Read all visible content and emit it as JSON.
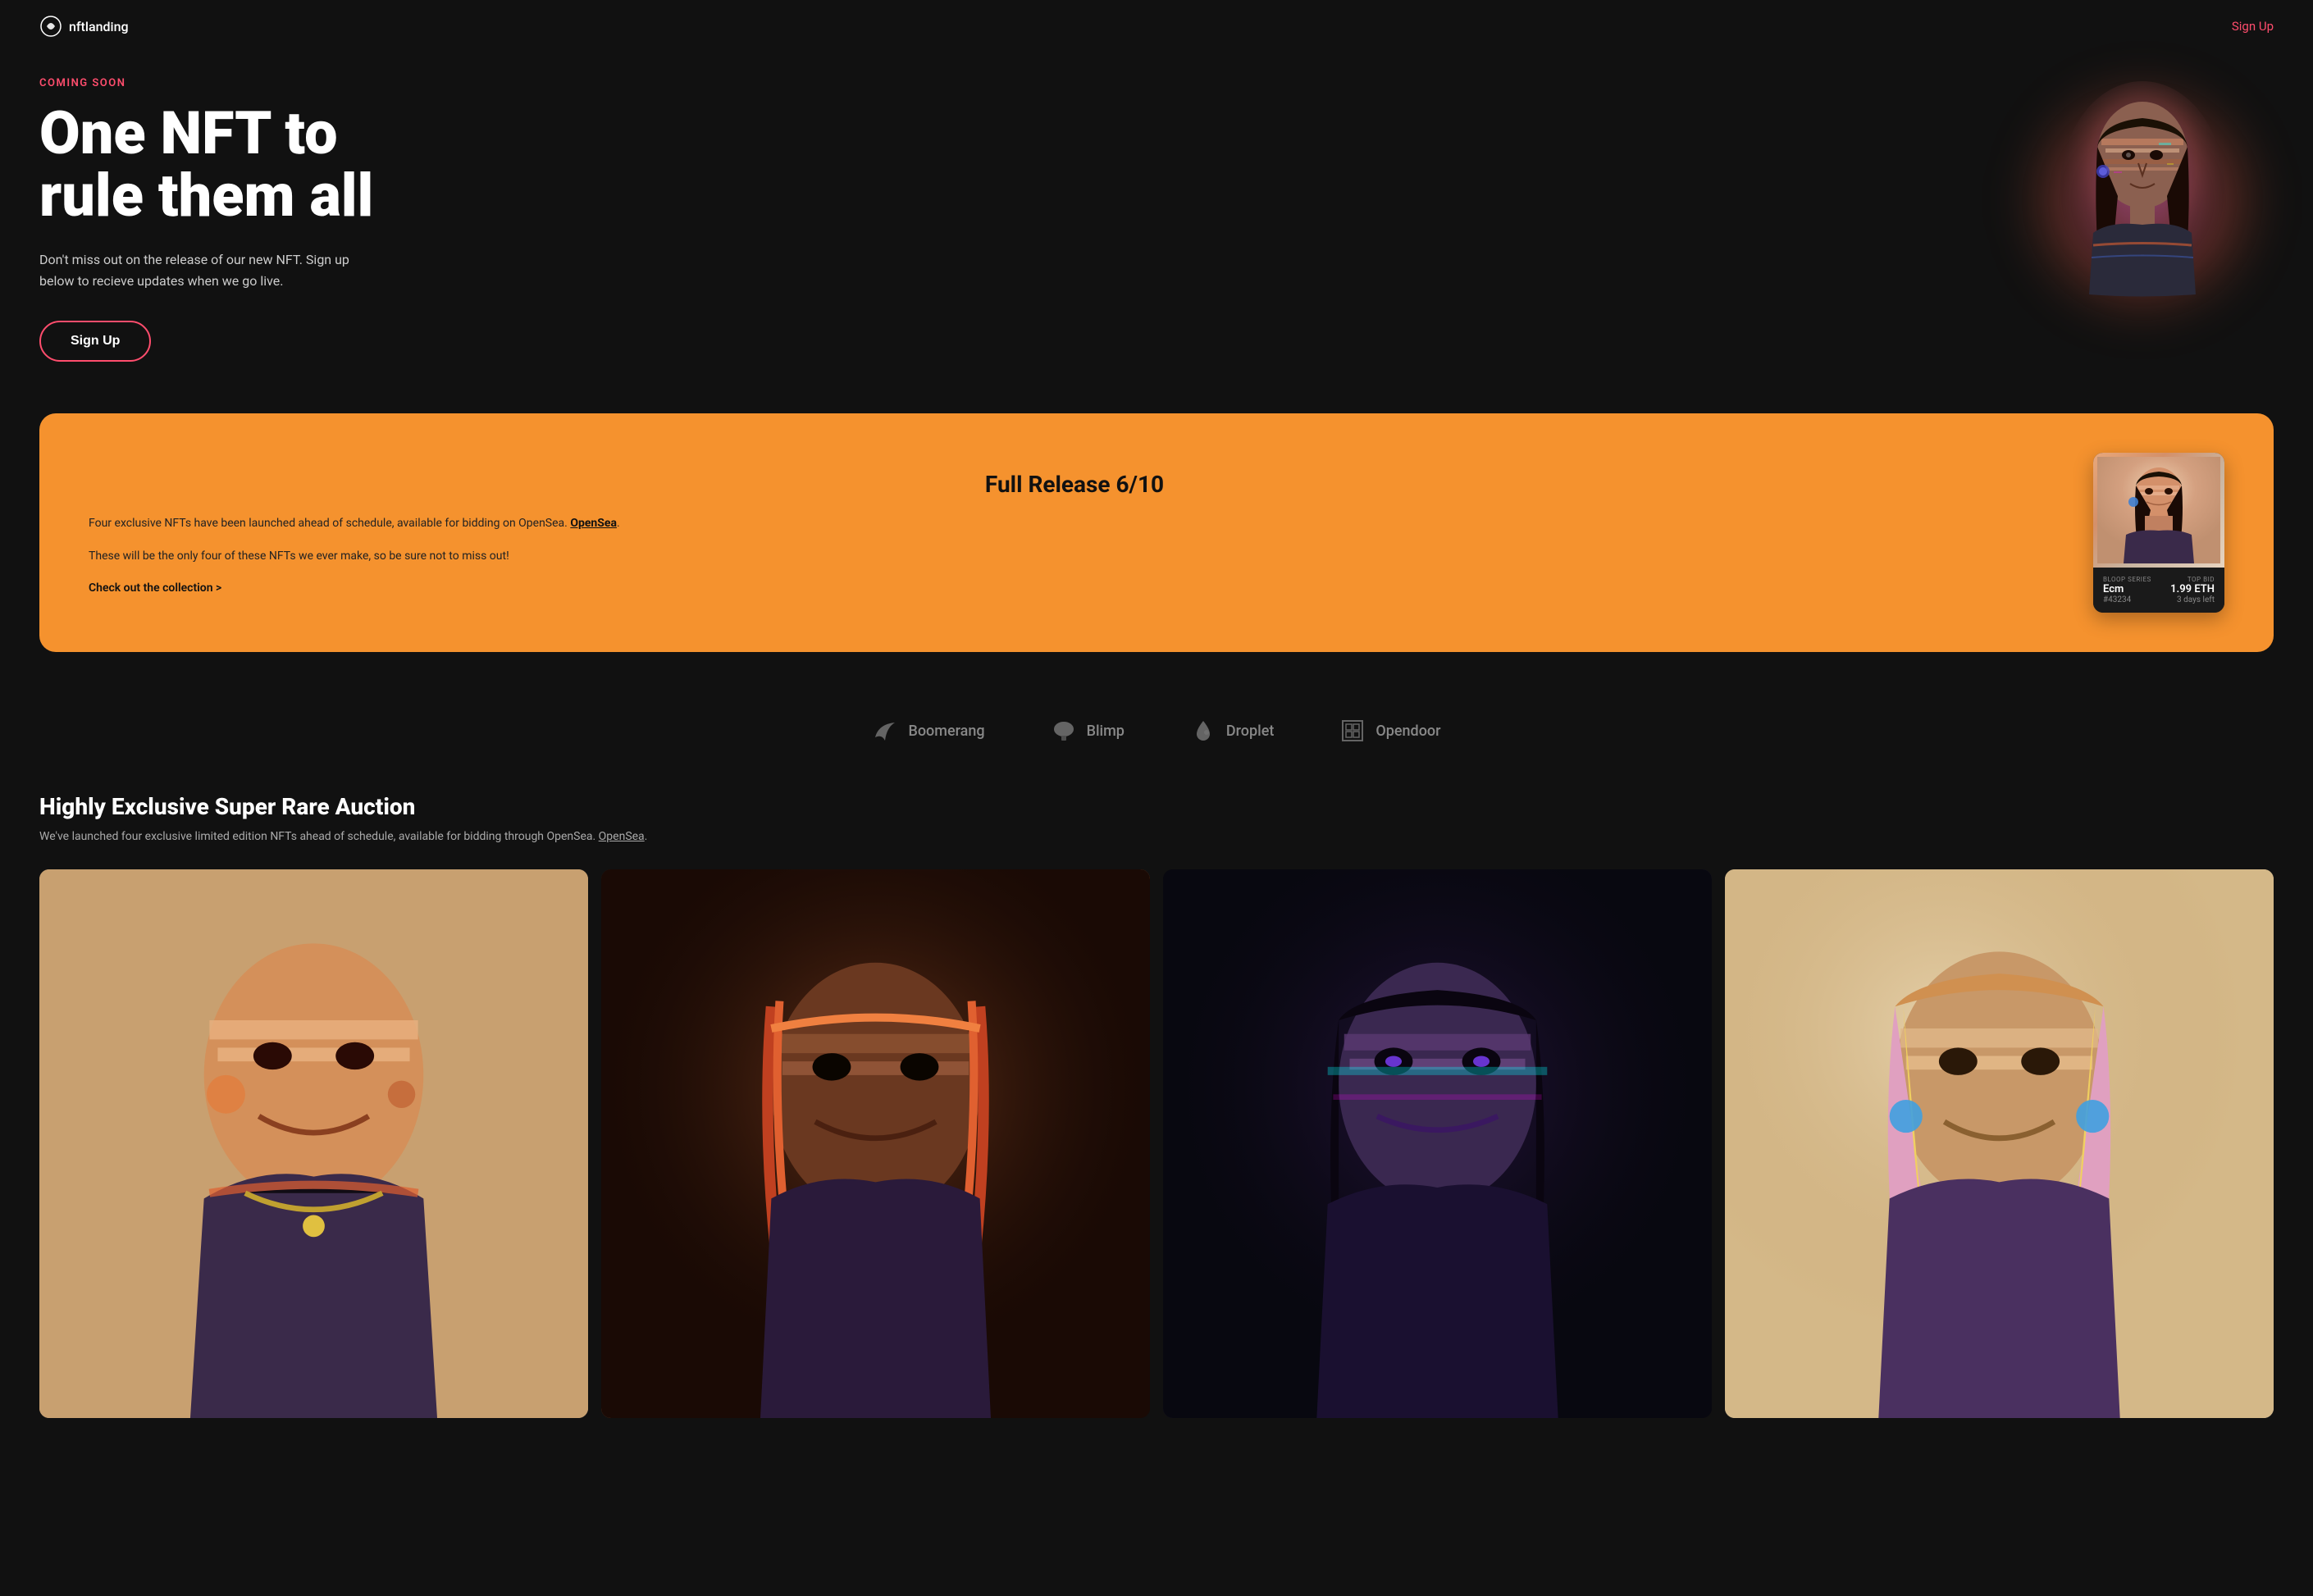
{
  "nav": {
    "logo_text": "nftlanding",
    "signup_label": "Sign Up"
  },
  "hero": {
    "badge": "COMING SOON",
    "title_line1": "One NFT to",
    "title_line2": "rule them all",
    "description": "Don't miss out on the release of our new NFT. Sign up below to recieve updates when we go live.",
    "signup_button": "Sign Up"
  },
  "release_card": {
    "title": "Full Release 6/10",
    "paragraph1": "Four exclusive NFTs have been launched ahead of schedule, available for bidding on OpenSea.",
    "paragraph2": "These will be the only four of these NFTs we ever make, so be sure not to miss out!",
    "link_label": "Check out the collection >",
    "nft": {
      "series_label": "BLOOP SERIES",
      "series_name": "Ecm",
      "nft_id": "#43234",
      "bid_label": "TOP BID",
      "bid_value": "1.99 ETH",
      "time_left": "3 days left"
    }
  },
  "partners": [
    {
      "name": "Boomerang",
      "icon": "boomerang"
    },
    {
      "name": "Blimp",
      "icon": "blimp"
    },
    {
      "name": "Droplet",
      "icon": "droplet"
    },
    {
      "name": "Opendoor",
      "icon": "opendoor"
    }
  ],
  "auction": {
    "title": "Highly Exclusive Super Rare Auction",
    "description": "We've launched four exclusive limited edition NFTs ahead of schedule, available for bidding through OpenSea.",
    "opensea_link": "OpenSea",
    "cards": [
      {
        "id": 1,
        "alt": "NFT artwork 1"
      },
      {
        "id": 2,
        "alt": "NFT artwork 2"
      },
      {
        "id": 3,
        "alt": "NFT artwork 3"
      },
      {
        "id": 4,
        "alt": "NFT artwork 4"
      }
    ]
  }
}
